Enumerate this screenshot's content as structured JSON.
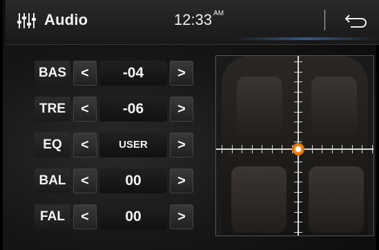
{
  "header": {
    "icon": "equalizer-icon",
    "title": "Audio",
    "time": "12:33",
    "ampm": "AM",
    "back_icon": "back-arrow-icon"
  },
  "controls": [
    {
      "label": "BAS",
      "value": "-04",
      "dec": "<",
      "inc": ">"
    },
    {
      "label": "TRE",
      "value": "-06",
      "dec": "<",
      "inc": ">"
    },
    {
      "label": "EQ",
      "value": "USER",
      "dec": "<",
      "inc": ">"
    },
    {
      "label": "BAL",
      "value": "00",
      "dec": "<",
      "inc": ">"
    },
    {
      "label": "FAL",
      "value": "00",
      "dec": "<",
      "inc": ">"
    }
  ],
  "fader": {
    "balance": 0,
    "fade": 0,
    "cursor_color": "#f08a1a"
  }
}
